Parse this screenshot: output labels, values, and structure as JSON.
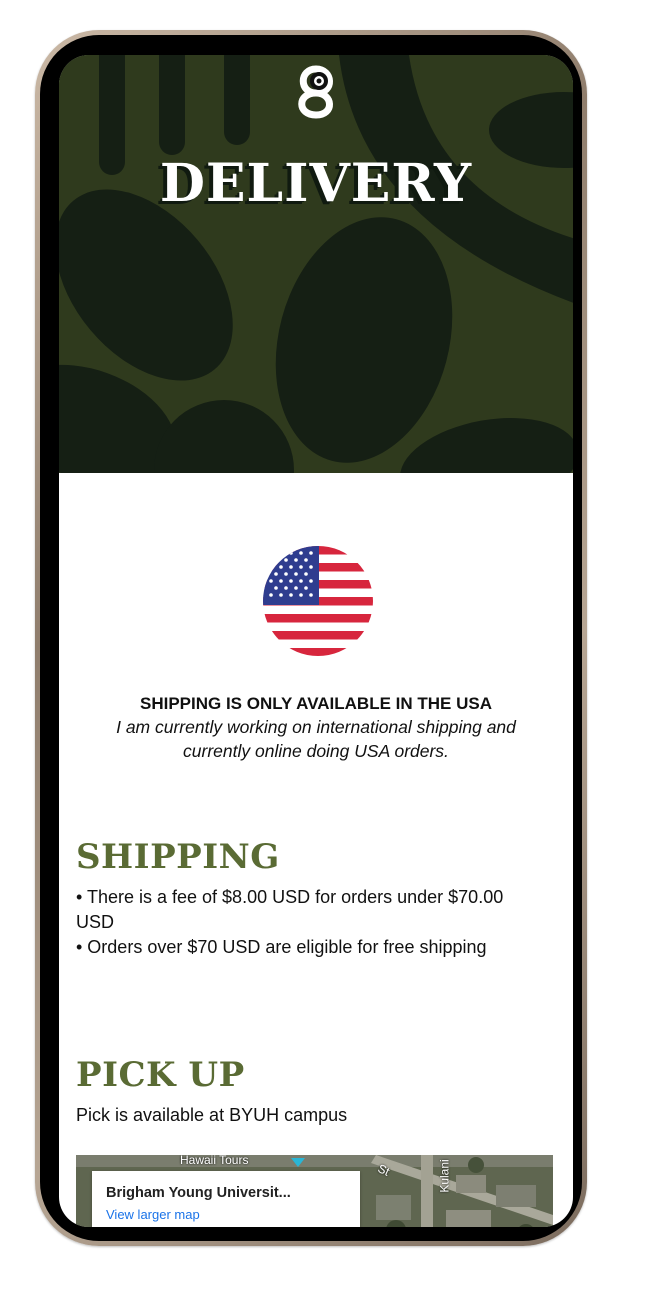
{
  "hero": {
    "title": "DELIVERY"
  },
  "notice": {
    "title": "SHIPPING IS ONLY AVAILABLE IN THE USA",
    "description": "I am currently working on international shipping and currently online doing USA orders.",
    "flag_icon": "usa-flag-icon"
  },
  "shipping": {
    "title": "SHIPPING",
    "points": [
      "• There is a fee of $8.00 USD for orders under $70.00 USD",
      "• Orders over $70 USD are eligible for free shipping"
    ]
  },
  "pickup": {
    "title": "PICK UP",
    "text": "Pick is available at BYUH campus"
  },
  "map": {
    "place_name": "Brigham Young Universit...",
    "link_label": "View larger map",
    "labels": [
      "Hawaii Tours",
      "Kulani",
      "St"
    ]
  },
  "colors": {
    "hero_bg": "#2f3a1d",
    "hero_shape": "#151f14",
    "section_title": "#5a6b34"
  }
}
